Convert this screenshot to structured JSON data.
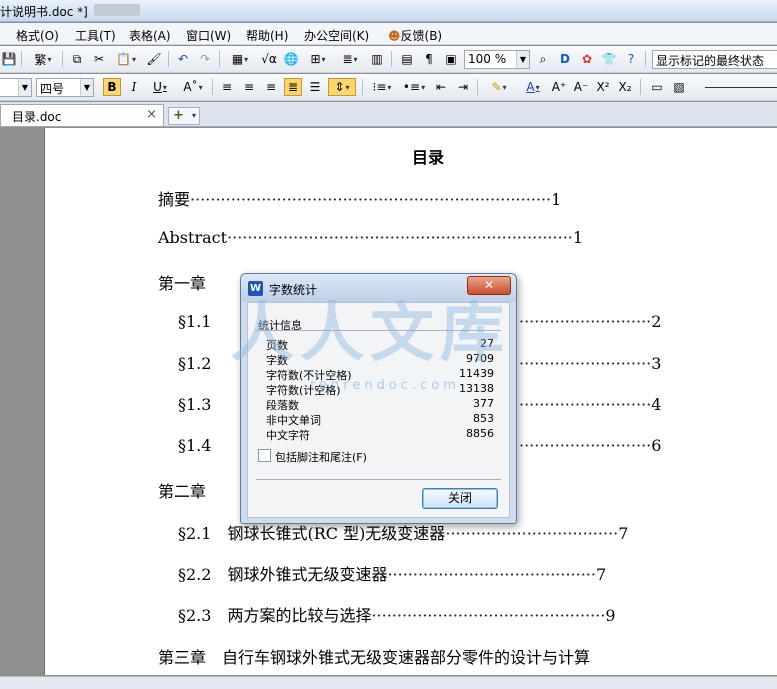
{
  "titlebar": {
    "title": "计说明书.doc *]"
  },
  "menu": [
    {
      "label": "格式(O)"
    },
    {
      "label": "工具(T)"
    },
    {
      "label": "表格(A)"
    },
    {
      "label": "窗口(W)"
    },
    {
      "label": "帮助(H)"
    },
    {
      "label": "办公空间(K)"
    },
    {
      "label": "反馈(B)"
    }
  ],
  "toolbar1": {
    "traditional_label": "繁",
    "zoom": "100 %",
    "markup_display": "显示标记的最终状态"
  },
  "toolbar2": {
    "font_size": "四号",
    "bold": "B",
    "italic": "I",
    "underline": "U"
  },
  "tabs": {
    "doc": "目录.doc",
    "close": "×",
    "new": "+"
  },
  "document": {
    "title": "目录",
    "toc": [
      {
        "label": "摘要",
        "page": "1"
      },
      {
        "label": "Abstract",
        "page": "1"
      },
      {
        "label": "第一章",
        "page": ""
      },
      {
        "label": "§1.1",
        "page": "2"
      },
      {
        "label": "§1.2",
        "page": "3"
      },
      {
        "label": "§1.3",
        "page": "4"
      },
      {
        "label": "§1.4",
        "page": "6"
      },
      {
        "label": "第二章",
        "page": ""
      },
      {
        "label": "§2.1　钢球长锥式(RC 型)无级变速器",
        "page": "7"
      },
      {
        "label": "§2.2　钢球外锥式无级变速器",
        "page": "7"
      },
      {
        "label": "§2.3　两方案的比较与选择",
        "page": "9"
      },
      {
        "label": "第三章　自行车钢球外锥式无级变速器部分零件的设计与计算",
        "page": ""
      }
    ]
  },
  "dialog": {
    "title": "字数统计",
    "close_x": "✕",
    "group_label": "统计信息",
    "stats": [
      {
        "label": "页数",
        "value": "27"
      },
      {
        "label": "字数",
        "value": "9709"
      },
      {
        "label": "字符数(不计空格)",
        "value": "11439"
      },
      {
        "label": "字符数(计空格)",
        "value": "13138"
      },
      {
        "label": "段落数",
        "value": "377"
      },
      {
        "label": "非中文单词",
        "value": "853"
      },
      {
        "label": "中文字符",
        "value": "8856"
      }
    ],
    "checkbox_label": "包括脚注和尾注(F)",
    "button": "关闭"
  },
  "watermark": {
    "text": "人人文库",
    "url": "renrendoc.com"
  }
}
